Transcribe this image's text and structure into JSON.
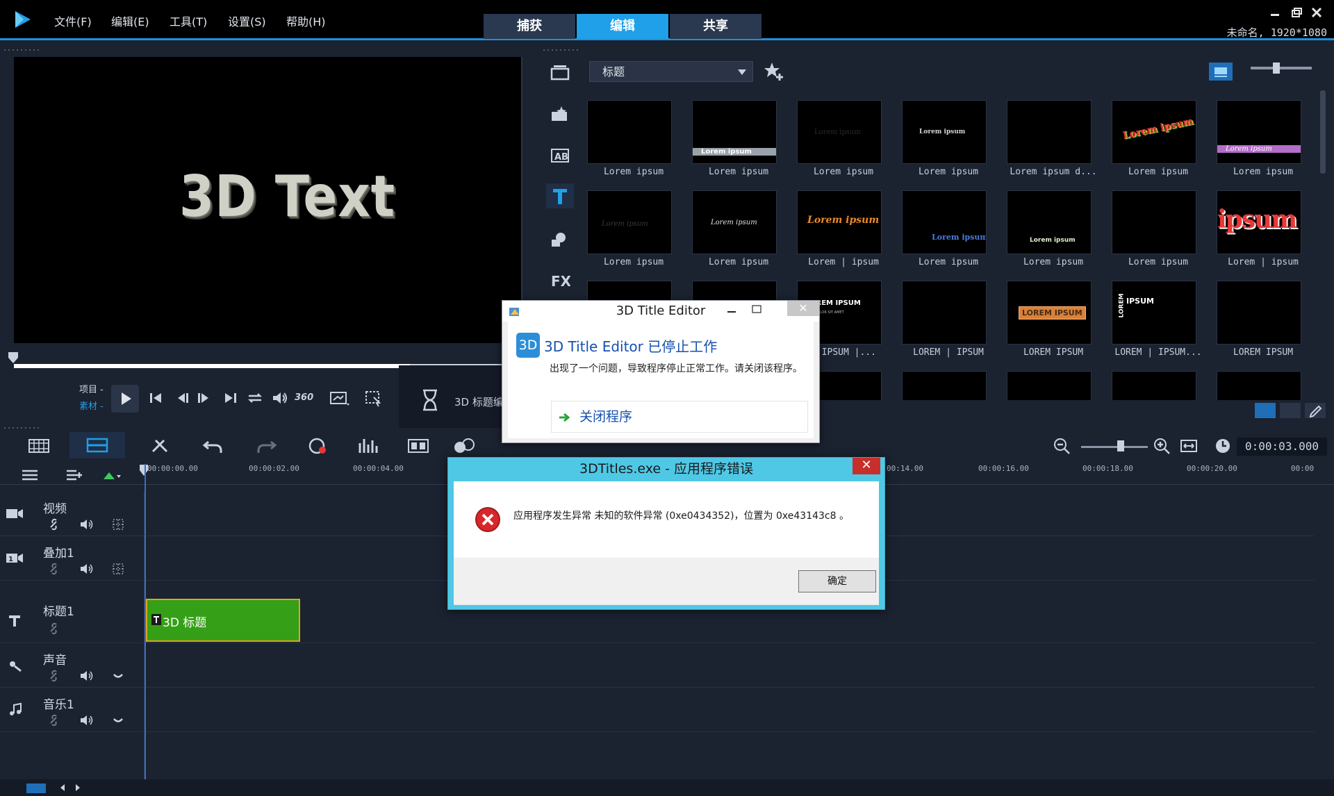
{
  "menu": {
    "file": "文件(F)",
    "edit": "编辑(E)",
    "tools": "工具(T)",
    "settings": "设置(S)",
    "help": "帮助(H)"
  },
  "tabs": [
    "捕获",
    "编辑",
    "共享"
  ],
  "active_tab": "编辑",
  "project_info": "未命名, 1920*1080",
  "player": {
    "preview_text": "3D Text",
    "label_project": "项目 -",
    "label_clip": "素材 -",
    "rotate_badge": "360"
  },
  "library": {
    "category": "标题",
    "thumbnails": [
      [
        "Lorem ipsum",
        "Lorem ipsum",
        "Lorem ipsum",
        "Lorem ipsum",
        "Lorem ipsum d...",
        "Lorem ipsum",
        "Lorem ipsum"
      ],
      [
        "Lorem ipsum",
        "Lorem ipsum",
        "Lorem | ipsum",
        "Lorem ipsum",
        "Lorem ipsum",
        "Lorem ipsum",
        "Lorem | ipsum"
      ],
      [
        "",
        "",
        "| IPSUM |...",
        "LOREM | IPSUM",
        "LOREM IPSUM",
        "LOREM | IPSUM...",
        "LOREM IPSUM"
      ]
    ],
    "thumb_texts": {
      "t2": "Lorem ipsum",
      "t3": "Lorem ipsum",
      "t4": "Lorem ipsum",
      "t6": "Lorem ipsum",
      "t7": "Lorem ipsum",
      "t8": "Lorem ipsum",
      "t9": "Lorem ipsum",
      "t10": "Lorem ipsum",
      "t11": "Lorem ipsum",
      "t12": "Lorem ipsum",
      "t14": "ipsum",
      "t17": "LOREM IPSUM",
      "t17b": "DOLOR SIT AMET",
      "t19": "LOREM IPSUM",
      "t20a": "LOREM",
      "t20b": "IPSUM"
    }
  },
  "timeline": {
    "timecode": "0:00:03.000",
    "ruler": [
      "00:00:00.00",
      "00:00:02.00",
      "00:00:04.00",
      "00:14.00",
      "00:00:16.00",
      "00:00:18.00",
      "00:00:20.00",
      "00:00"
    ],
    "tracks": [
      "视频",
      "叠加1",
      "标题1",
      "声音",
      "音乐1"
    ],
    "clip_label": "3D 标题"
  },
  "render": {
    "label": "3D 标题编"
  },
  "title_editor_dialog": {
    "title": "3D Title Editor",
    "icon_label": "3D",
    "heading": "3D Title Editor 已停止工作",
    "message": "出现了一个问题，导致程序停止正常工作。请关闭该程序。",
    "close_button": "关闭程序"
  },
  "error_dialog": {
    "title": "3DTitles.exe - 应用程序错误",
    "message": "应用程序发生异常 未知的软件异常 (0xe0434352)，位置为 0xe43143c8 。",
    "ok_button": "确定"
  },
  "colors": {
    "accent": "#1fa0e8",
    "clip_green": "#35a017",
    "clip_border": "#e5a11f",
    "error_frame": "#4fc8e6",
    "error_close": "#c7302a"
  }
}
